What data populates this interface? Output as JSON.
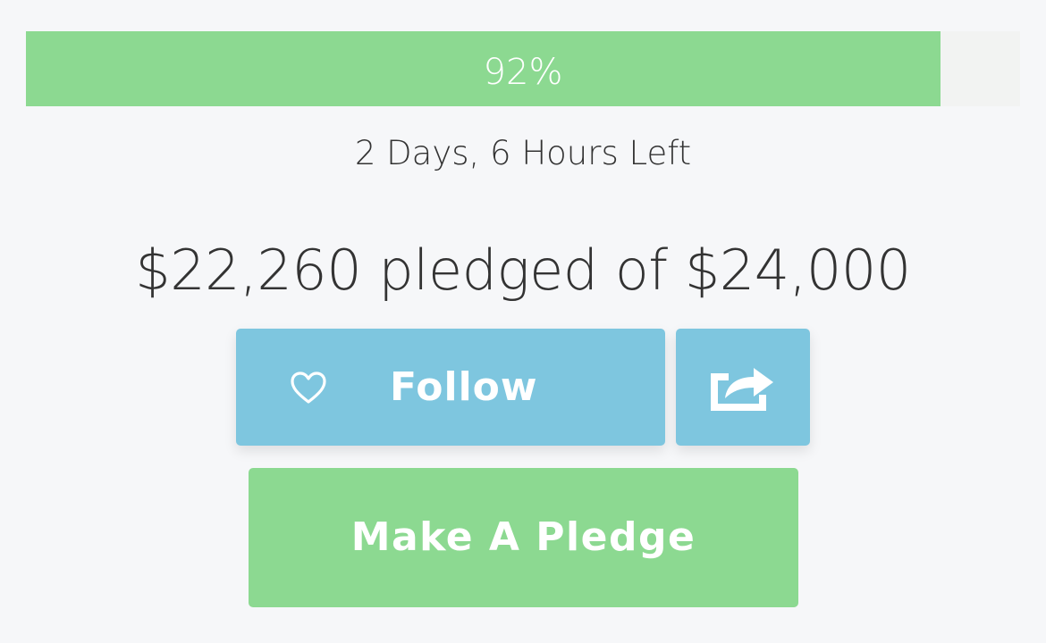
{
  "progress": {
    "percent": 92,
    "label": "92%",
    "fill_color": "#8cd991",
    "track_color": "#f2f3f2"
  },
  "time_left": "2 Days, 6 Hours Left",
  "pledge_summary": "$22,260 pledged of $24,000",
  "buttons": {
    "follow": {
      "label": "Follow",
      "icon": "heart-outline-icon",
      "color": "#7ec6df"
    },
    "share": {
      "icon": "share-icon",
      "color": "#7ec6df"
    },
    "pledge": {
      "label": "Make A Pledge",
      "color": "#8cd991"
    }
  }
}
